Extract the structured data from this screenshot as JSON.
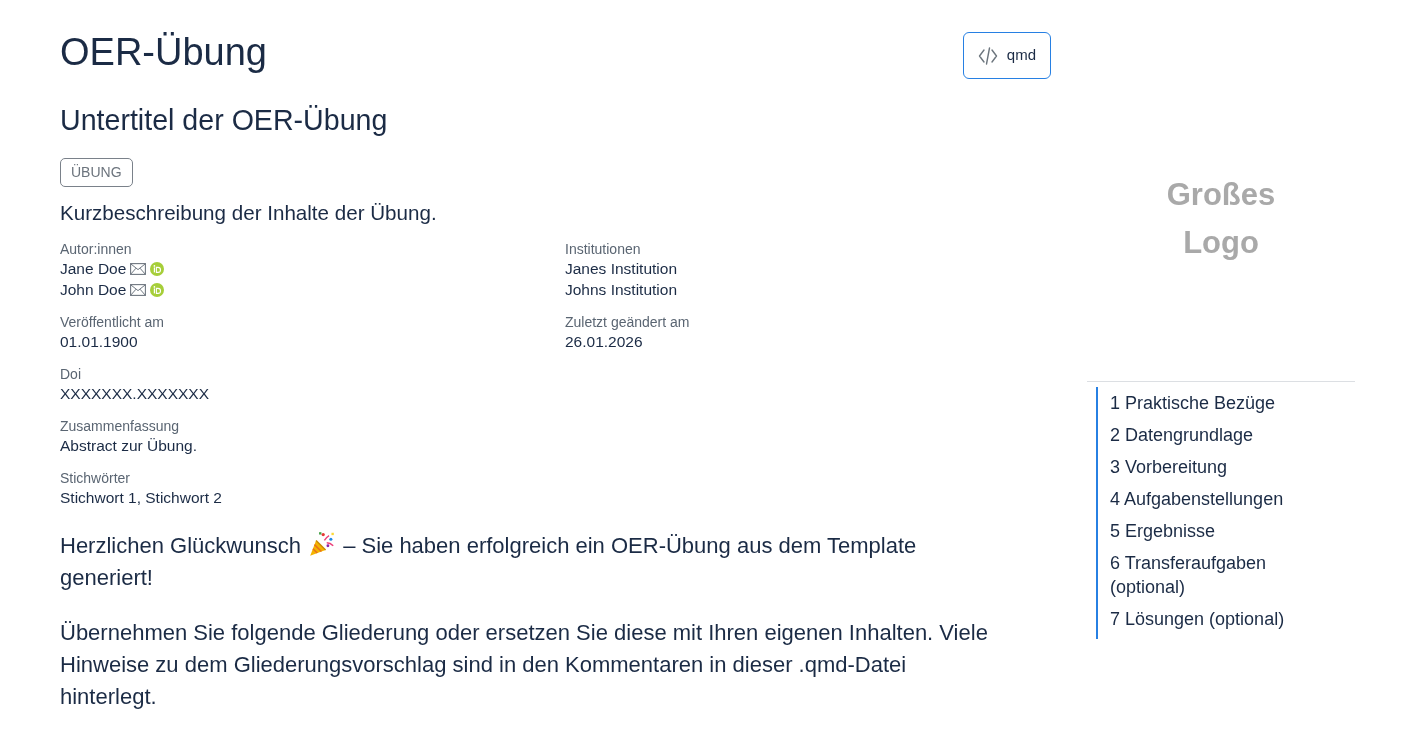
{
  "header": {
    "title": "OER-Übung",
    "subtitle": "Untertitel der OER-Übung",
    "category": "ÜBUNG",
    "description": "Kurzbeschreibung der Inhalte der Übung.",
    "source_button": {
      "label": "qmd"
    }
  },
  "metadata": {
    "authors": {
      "label": "Autor:innen",
      "items": [
        {
          "name": "Jane Doe"
        },
        {
          "name": "John Doe"
        }
      ]
    },
    "affiliations": {
      "label": "Institutionen",
      "items": [
        "Janes Institution",
        "Johns Institution"
      ]
    },
    "published": {
      "label": "Veröffentlicht am",
      "value": "01.01.1900"
    },
    "modified": {
      "label": "Zuletzt geändert am",
      "value": "26.01.2026"
    },
    "fields": [
      {
        "label": "Doi",
        "value": "XXXXXXX.XXXXXXX"
      },
      {
        "label": "Zusammenfassung",
        "value": "Abstract zur Übung."
      },
      {
        "label": "Stichwörter",
        "value": "Stichwort 1, Stichwort 2"
      }
    ]
  },
  "body": [
    {
      "parts": [
        {
          "kind": "text",
          "text": "Herzlichen Glückwunsch"
        },
        {
          "kind": "icon"
        },
        {
          "kind": "text",
          "text": "– Sie haben erfolgreich ein OER-Übung aus dem Template generiert!"
        }
      ]
    },
    {
      "parts": [
        {
          "kind": "text",
          "text": "Übernehmen Sie folgende Gliederung oder ersetzen Sie diese mit Ihren eigenen Inhalten. Viele Hinweise zu dem Gliederungsvorschlag sind in den Kommentaren in dieser .qmd-Datei hinterlegt."
        }
      ]
    }
  ],
  "sidebar": {
    "logo": "Großes Logo",
    "toc": [
      "1 Praktische Bezüge",
      "2 Datengrundlage",
      "3 Vorbereitung",
      "4 Aufgabenstellungen",
      "5 Ergebnisse",
      "6 Transferaufgaben (optional)",
      "7 Lösungen (optional)"
    ]
  }
}
